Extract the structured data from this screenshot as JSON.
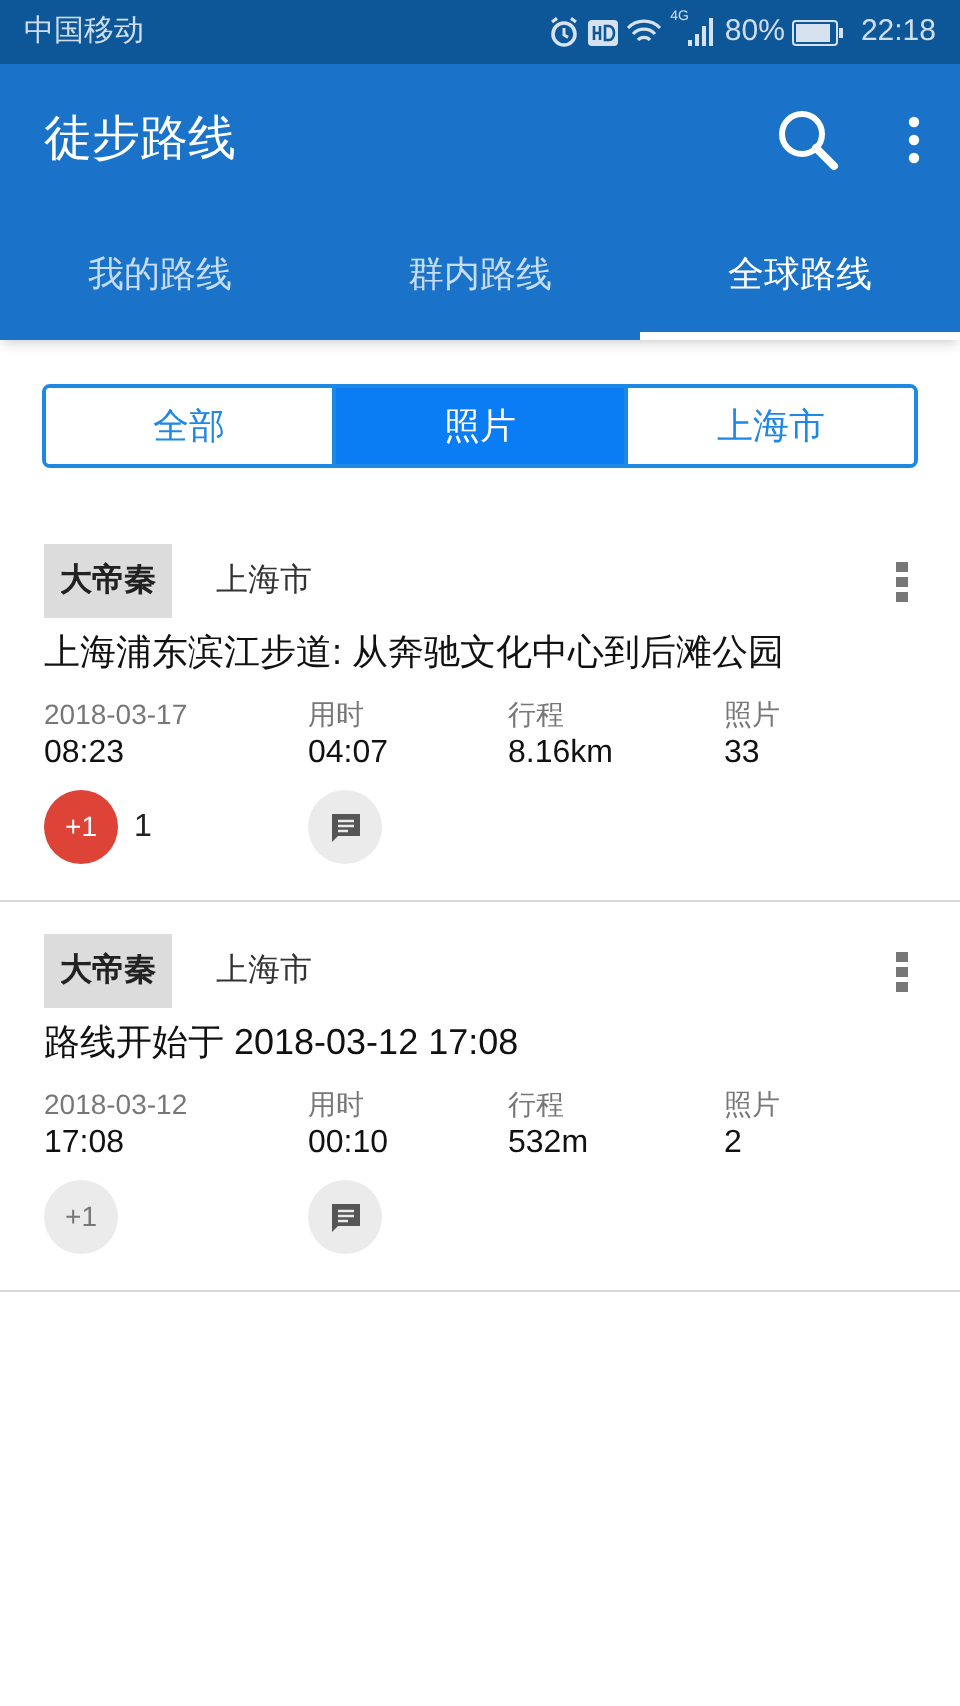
{
  "status_bar": {
    "carrier": "中国移动",
    "network": "4G",
    "battery": "80%",
    "time": "22:18"
  },
  "app_bar": {
    "title": "徒步路线"
  },
  "tabs": [
    {
      "label": "我的路线",
      "selected": false
    },
    {
      "label": "群内路线",
      "selected": false
    },
    {
      "label": "全球路线",
      "selected": true
    }
  ],
  "filters": [
    {
      "label": "全部",
      "selected": false
    },
    {
      "label": "照片",
      "selected": true
    },
    {
      "label": "上海市",
      "selected": false
    }
  ],
  "routes": [
    {
      "author": "大帝秦",
      "city": "上海市",
      "title": "上海浦东滨江步道: 从奔驰文化中心到后滩公园",
      "date": "2018-03-17",
      "time": "08:23",
      "duration_label": "用时",
      "duration": "04:07",
      "distance_label": "行程",
      "distance": "8.16km",
      "photos_label": "照片",
      "photos": "33",
      "plus_one": "+1",
      "liked": true,
      "like_count": "1"
    },
    {
      "author": "大帝秦",
      "city": "上海市",
      "title": "路线开始于 2018-03-12 17:08",
      "date": "2018-03-12",
      "time": "17:08",
      "duration_label": "用时",
      "duration": "00:10",
      "distance_label": "行程",
      "distance": "532m",
      "photos_label": "照片",
      "photos": "2",
      "plus_one": "+1",
      "liked": false
    }
  ]
}
